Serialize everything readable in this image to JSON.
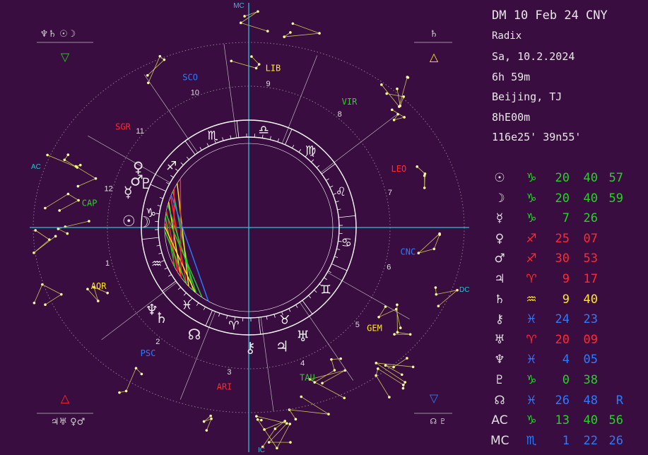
{
  "header": {
    "title": "DM 10 Feb 24 CNY",
    "chart_type": "Radix",
    "date": "Sa, 10.2.2024",
    "time": "6h 59m",
    "place": "Beijing, TJ",
    "zone": "8hE00m",
    "coords": "116e25'  39n55'"
  },
  "axes": {
    "mc": "MC",
    "ic": "IC",
    "ac": "AC",
    "dc": "DC"
  },
  "signs": [
    "CAP",
    "AQR",
    "PSC",
    "ARI",
    "TAU",
    "GEM",
    "CNC",
    "LEO",
    "VIR",
    "LIB",
    "SCO",
    "SGR"
  ],
  "houses": [
    "1",
    "2",
    "3",
    "4",
    "5",
    "6",
    "7",
    "8",
    "9",
    "10",
    "11",
    "12"
  ],
  "positions": [
    {
      "glyph": "☉",
      "sign": "♑",
      "sign_color": "#22d422",
      "deg": "20",
      "min": "40",
      "sec": "57",
      "extra": ""
    },
    {
      "glyph": "☽",
      "sign": "♑",
      "sign_color": "#22d422",
      "deg": "20",
      "min": "40",
      "sec": "59",
      "extra": ""
    },
    {
      "glyph": "☿",
      "sign": "♑",
      "sign_color": "#22d422",
      "deg": "7",
      "min": "26",
      "sec": "",
      "extra": ""
    },
    {
      "glyph": "♀",
      "sign": "♐",
      "sign_color": "#ff2a2a",
      "deg": "25",
      "min": "07",
      "sec": "",
      "extra": ""
    },
    {
      "glyph": "♂",
      "sign": "♐",
      "sign_color": "#ff2a2a",
      "deg": "30",
      "min": "53",
      "sec": "",
      "extra": ""
    },
    {
      "glyph": "♃",
      "sign": "♈",
      "sign_color": "#ff2a2a",
      "deg": "9",
      "min": "17",
      "sec": "",
      "extra": ""
    },
    {
      "glyph": "♄",
      "sign": "♒",
      "sign_color": "#ffe81a",
      "deg": "9",
      "min": "40",
      "sec": "",
      "extra": ""
    },
    {
      "glyph": "⚷",
      "sign": "♓",
      "sign_color": "#2a7cff",
      "deg": "24",
      "min": "23",
      "sec": "",
      "extra": ""
    },
    {
      "glyph": "♅",
      "sign": "♈",
      "sign_color": "#ff2a2a",
      "deg": "20",
      "min": "09",
      "sec": "",
      "extra": ""
    },
    {
      "glyph": "♆",
      "sign": "♓",
      "sign_color": "#2a7cff",
      "deg": "4",
      "min": "05",
      "sec": "",
      "extra": ""
    },
    {
      "glyph": "♇",
      "sign": "♑",
      "sign_color": "#22d422",
      "deg": "0",
      "min": "38",
      "sec": "",
      "extra": ""
    },
    {
      "glyph": "☊",
      "sign": "♓",
      "sign_color": "#2a7cff",
      "deg": "26",
      "min": "48",
      "sec": "",
      "extra": "R"
    },
    {
      "glyph": "AC",
      "sign": "♑",
      "sign_color": "#22d422",
      "deg": "13",
      "min": "40",
      "sec": "56",
      "extra": ""
    },
    {
      "glyph": "MC",
      "sign": "♏",
      "sign_color": "#2a7cff",
      "deg": "1",
      "min": "22",
      "sec": "26",
      "extra": ""
    }
  ],
  "corners": {
    "top_left_glyphs": "♆♄ ☉☽",
    "top_left_element": "▽",
    "top_right_glyphs": "♄",
    "top_right_element": "△",
    "bottom_left_glyphs": "♃♅  ♀♂",
    "bottom_left_element": "△",
    "bottom_right_glyphs": "☊ ♇",
    "bottom_right_element": "▽"
  },
  "colors": {
    "background": "#3a0d40",
    "axis": "#25c4d8",
    "fire": "#ff2a2a",
    "earth": "#22d422",
    "air": "#ffe81a",
    "water": "#2a7cff"
  }
}
